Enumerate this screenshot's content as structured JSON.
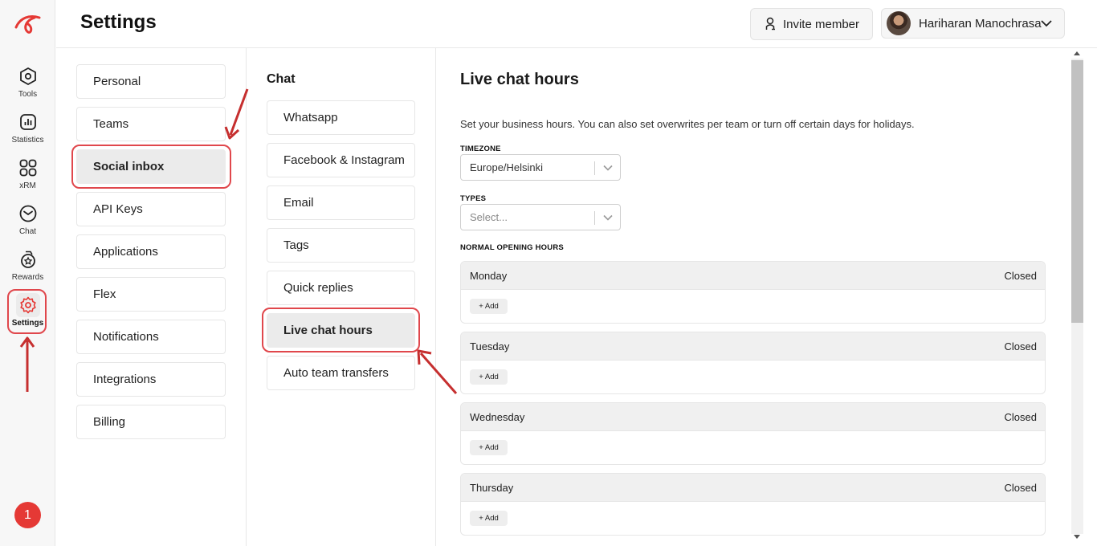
{
  "rail": {
    "items": [
      {
        "label": "Tools",
        "icon": "hexagon-icon"
      },
      {
        "label": "Statistics",
        "icon": "bar-chart-icon"
      },
      {
        "label": "xRM",
        "icon": "grid-icon"
      },
      {
        "label": "Chat",
        "icon": "chat-icon"
      },
      {
        "label": "Rewards",
        "icon": "rewards-icon"
      },
      {
        "label": "Settings",
        "icon": "gear-icon"
      }
    ],
    "notification_count": "1"
  },
  "header": {
    "title": "Settings",
    "invite_label": "Invite member",
    "user_name": "Hariharan Manochrasa"
  },
  "settings_menu": {
    "items": [
      "Personal",
      "Teams",
      "Social inbox",
      "API Keys",
      "Applications",
      "Flex",
      "Notifications",
      "Integrations",
      "Billing"
    ],
    "active": "Social inbox"
  },
  "chat_menu": {
    "title": "Chat",
    "items": [
      "Whatsapp",
      "Facebook & Instagram",
      "Email",
      "Tags",
      "Quick replies",
      "Live chat hours",
      "Auto team transfers"
    ],
    "active": "Live chat hours"
  },
  "main": {
    "title": "Live chat hours",
    "description": "Set your business hours. You can also set overwrites per team or turn off certain days for holidays.",
    "timezone": {
      "label": "TIMEZONE",
      "value": "Europe/Helsinki"
    },
    "types": {
      "label": "TYPES",
      "placeholder": "Select..."
    },
    "normal_hours_label": "NORMAL OPENING HOURS",
    "days": [
      {
        "name": "Monday",
        "status": "Closed",
        "add_label": "+ Add"
      },
      {
        "name": "Tuesday",
        "status": "Closed",
        "add_label": "+ Add"
      },
      {
        "name": "Wednesday",
        "status": "Closed",
        "add_label": "+ Add"
      },
      {
        "name": "Thursday",
        "status": "Closed",
        "add_label": "+ Add"
      }
    ]
  },
  "colors": {
    "accent": "#e53935",
    "highlight": "#e0474c"
  }
}
